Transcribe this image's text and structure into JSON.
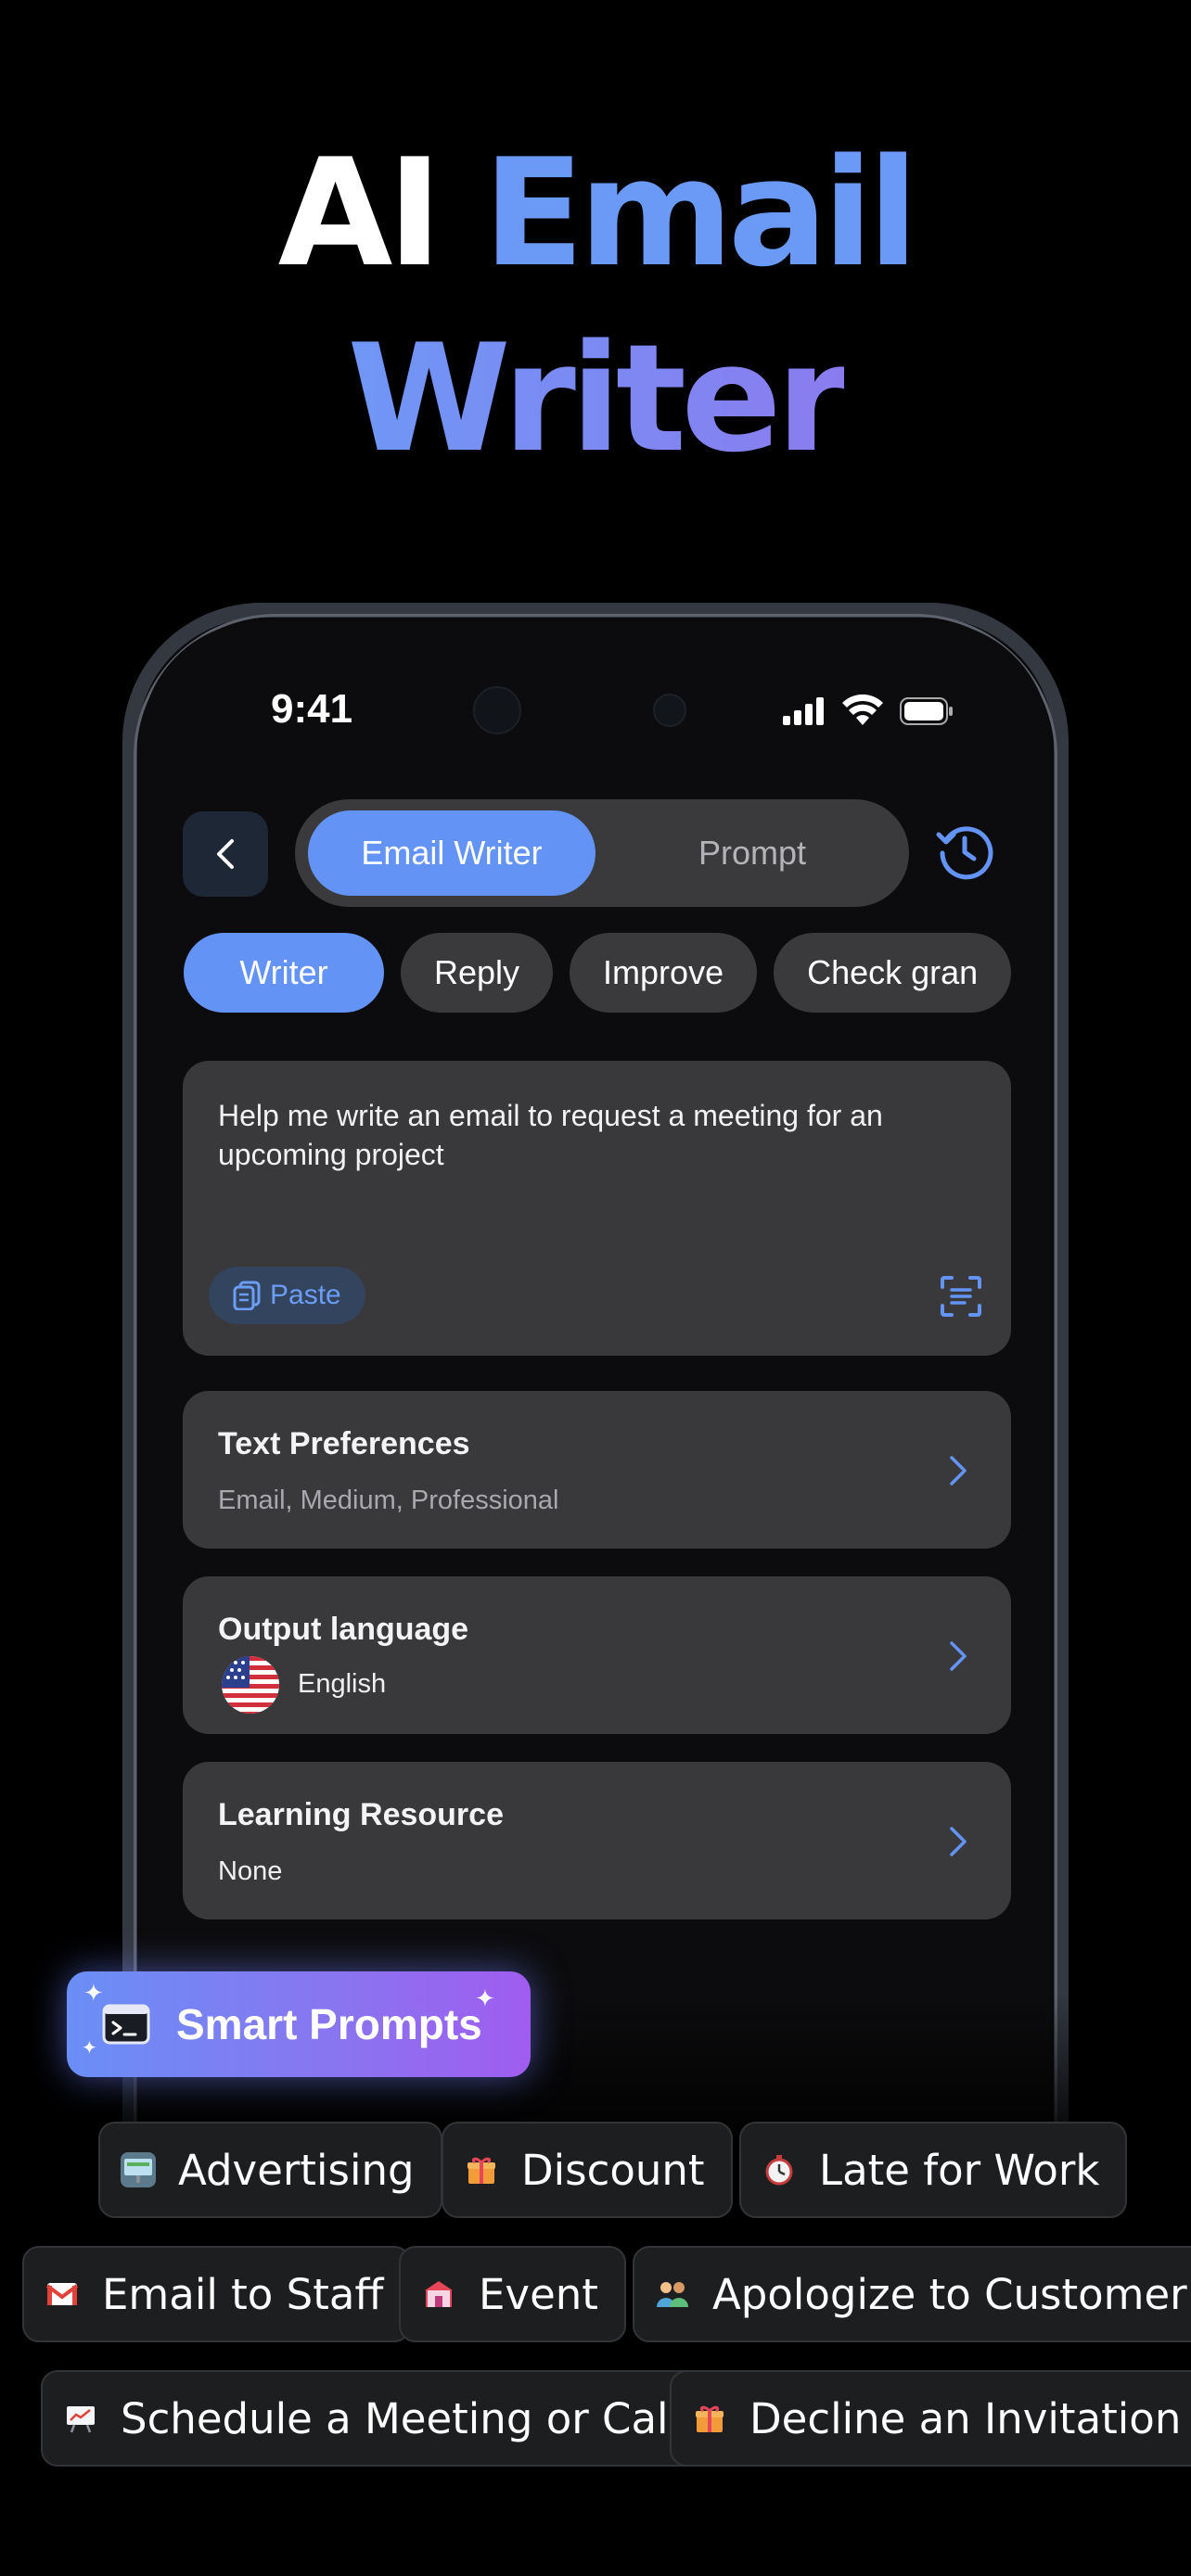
{
  "headline": {
    "line1_white": "AI",
    "line1_blue": "Email",
    "line2": "Writer"
  },
  "status_bar": {
    "time": "9:41"
  },
  "header": {
    "back_icon": "chevron-left-icon",
    "segments": [
      "Email Writer",
      "Prompt"
    ],
    "selected_segment": "Email Writer",
    "history_icon": "history-clock-icon"
  },
  "mode_chips": [
    "Writer",
    "Reply",
    "Improve",
    "Check gran"
  ],
  "selected_chip": "Writer",
  "prompt": {
    "text": "Help me write an email to request a meeting for an upcoming project",
    "paste_label": "Paste",
    "scan_icon": "scan-text-icon"
  },
  "settings": {
    "text_preferences": {
      "title": "Text Preferences",
      "value": "Email, Medium, Professional"
    },
    "output_language": {
      "title": "Output language",
      "value": "English",
      "flag_icon": "us-flag-icon"
    },
    "learning_resource": {
      "title": "Learning Resource",
      "value": "None"
    }
  },
  "smart_prompts": {
    "label": "Smart Prompts",
    "icon": "terminal-icon"
  },
  "prompt_tags": [
    {
      "label": "Advertising",
      "icon": "billboard-icon"
    },
    {
      "label": "Discount",
      "icon": "gift-icon"
    },
    {
      "label": "Late for Work",
      "icon": "stopwatch-icon"
    },
    {
      "label": "Email to Staff",
      "icon": "gmail-icon"
    },
    {
      "label": "Event",
      "icon": "carnival-icon"
    },
    {
      "label": "Apologize to Customer",
      "icon": "people-icon"
    },
    {
      "label": "Schedule a Meeting or Call",
      "icon": "chart-board-icon"
    },
    {
      "label": "Decline an Invitation",
      "icon": "gift-icon"
    }
  ],
  "colors": {
    "accent": "#6394F5",
    "card": "#39393B",
    "background": "#000000"
  }
}
